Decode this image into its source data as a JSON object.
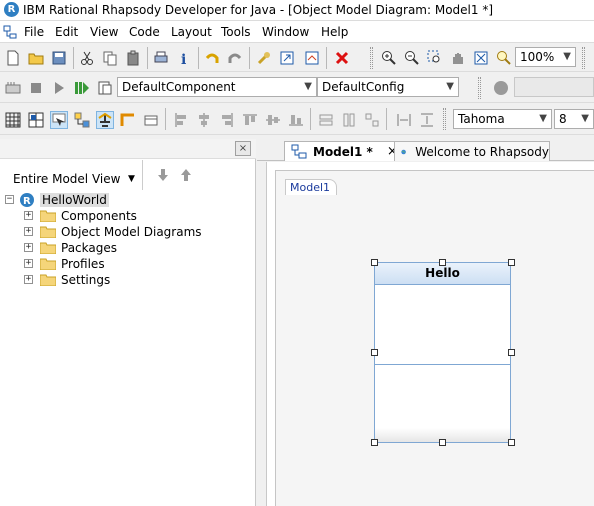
{
  "titlebar": {
    "app_icon": "rhapsody-logo-icon",
    "title": "IBM Rational Rhapsody Developer for Java - [Object Model Diagram: Model1 *]"
  },
  "menubar": {
    "items": [
      "File",
      "Edit",
      "View",
      "Code",
      "Layout",
      "Tools",
      "Window",
      "Help"
    ]
  },
  "toolbar1": {
    "zoom_value": "100%",
    "icons": [
      "new-icon",
      "open-icon",
      "save-icon",
      "cut-icon",
      "copy-icon",
      "paste-icon",
      "print-icon",
      "info-icon",
      "undo-icon",
      "redo-icon",
      "wrench-icon",
      "navigate-icon",
      "diagram-icon",
      "delete-icon",
      "zoom-in-icon",
      "zoom-out-icon",
      "zoom-region-icon",
      "pan-icon",
      "zoom-fit-icon",
      "zoom-percent-icon"
    ]
  },
  "toolbar2": {
    "component_value": "DefaultComponent",
    "config_value": "DefaultConfig",
    "icons": [
      "make-icon",
      "stop-icon",
      "run-icon",
      "generate-make-run-icon",
      "active-code-view-icon"
    ]
  },
  "toolbar3": {
    "font_value": "Tahoma",
    "font_size_value": "8",
    "icons": [
      "grid-icon",
      "snap-icon",
      "select-icon",
      "layout-icon",
      "stamp-icon",
      "line-style-icon",
      "frame-icon",
      "align-left-icon",
      "align-center-icon",
      "align-right-icon",
      "align-top-icon",
      "align-middle-icon",
      "align-bottom-icon",
      "same-width-icon",
      "same-height-icon",
      "same-size-icon",
      "space-horizontal-icon",
      "space-vertical-icon"
    ]
  },
  "browser": {
    "close_label": "×",
    "view_label": "Entire Model View",
    "root": "HelloWorld",
    "items": [
      "Components",
      "Object Model Diagrams",
      "Packages",
      "Profiles",
      "Settings"
    ]
  },
  "tabs": [
    {
      "label": "Model1 *",
      "close": "×",
      "icon": "object-model-diagram-icon"
    },
    {
      "label": "Welcome to Rhapsody",
      "icon": "globe-icon"
    }
  ],
  "diagram": {
    "frame_label": "Model1",
    "class_name": "Hello"
  }
}
